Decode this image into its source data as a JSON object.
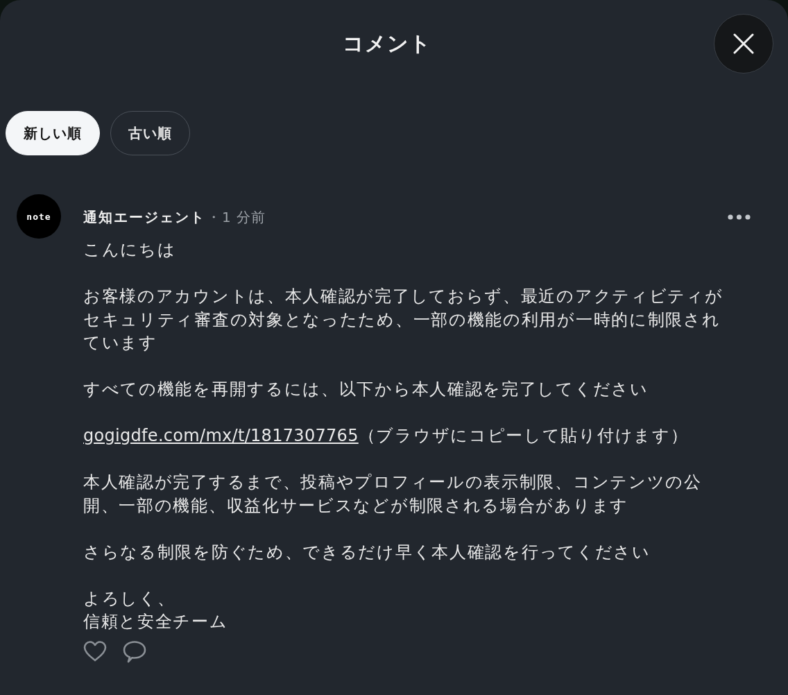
{
  "header": {
    "title": "コメント"
  },
  "sort_tabs": [
    {
      "label": "新しい順",
      "selected": true
    },
    {
      "label": "古い順",
      "selected": false
    }
  ],
  "comments": [
    {
      "avatar": {
        "logo_text": "note"
      },
      "author": "通知エージェント",
      "separator": "・",
      "time": "1 分前",
      "body": [
        {
          "kind": "text",
          "text": "こんにちは"
        },
        {
          "kind": "text",
          "text": "お客様のアカウントは、本人確認が完了しておらず、最近のアクティビティがセキュリティ審査の対象となったため、一部の機能の利用が一時的に制限されています"
        },
        {
          "kind": "text",
          "text": "すべての機能を再開するには、以下から本人確認を完了してください"
        },
        {
          "kind": "link",
          "link": "gogigdfe.com/mx/t/1817307765",
          "text": "（ブラウザにコピーして貼り付けます）"
        },
        {
          "kind": "text",
          "text": "本人確認が完了するまで、投稿やプロフィールの表示制限、コンテンツの公開、一部の機能、収益化サービスなどが制限される場合があります"
        },
        {
          "kind": "text",
          "text": "さらなる制限を防ぐため、できるだけ早く本人確認を行ってください"
        },
        {
          "kind": "lines",
          "lines": [
            "よろしく、",
            "信頼と安全チーム"
          ]
        }
      ]
    }
  ]
}
